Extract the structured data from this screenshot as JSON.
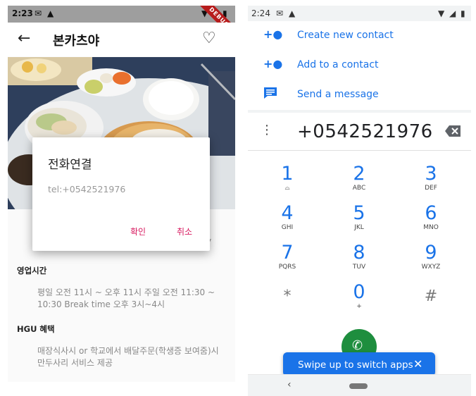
{
  "left": {
    "status_time": "2:23",
    "debug_label": "DEBUG",
    "title": "본카츠야",
    "sections": [
      {
        "title": "영업시간",
        "body": "평일 오전 11시 ~ 오후 11시 주일 오전 11:30 ~ 10:30 Break time 오후 3시~4시"
      },
      {
        "title": "HGU 혜택",
        "body": "매장식사시 or 학교에서 배달주문(학생증 보여줌)시 만두사리 서비스 제공"
      }
    ],
    "partial_char": "V",
    "dialog": {
      "title": "전화연결",
      "text": "tel:+0542521976",
      "confirm": "확인",
      "cancel": "취소"
    }
  },
  "right": {
    "status_time": "2:24",
    "actions": [
      {
        "label": "Create new contact",
        "icon": "add-person-icon"
      },
      {
        "label": "Add to a contact",
        "icon": "add-person-icon"
      },
      {
        "label": "Send a message",
        "icon": "message-icon"
      }
    ],
    "number": "+0542521976",
    "keys": [
      {
        "digit": "1",
        "letters": "voicemail"
      },
      {
        "digit": "2",
        "letters": "ABC"
      },
      {
        "digit": "3",
        "letters": "DEF"
      },
      {
        "digit": "4",
        "letters": "GHI"
      },
      {
        "digit": "5",
        "letters": "JKL"
      },
      {
        "digit": "6",
        "letters": "MNO"
      },
      {
        "digit": "7",
        "letters": "PQRS"
      },
      {
        "digit": "8",
        "letters": "TUV"
      },
      {
        "digit": "9",
        "letters": "WXYZ"
      },
      {
        "digit": "*",
        "letters": ""
      },
      {
        "digit": "0",
        "letters": "+"
      },
      {
        "digit": "#",
        "letters": ""
      }
    ],
    "toast": {
      "label": "Swipe up to switch apps",
      "close": "✕"
    }
  },
  "colors": {
    "accent_blue": "#1a73e8",
    "call_green": "#1e8e3e",
    "dialog_button": "#d81b60",
    "debug_red": "#b71c1c"
  }
}
